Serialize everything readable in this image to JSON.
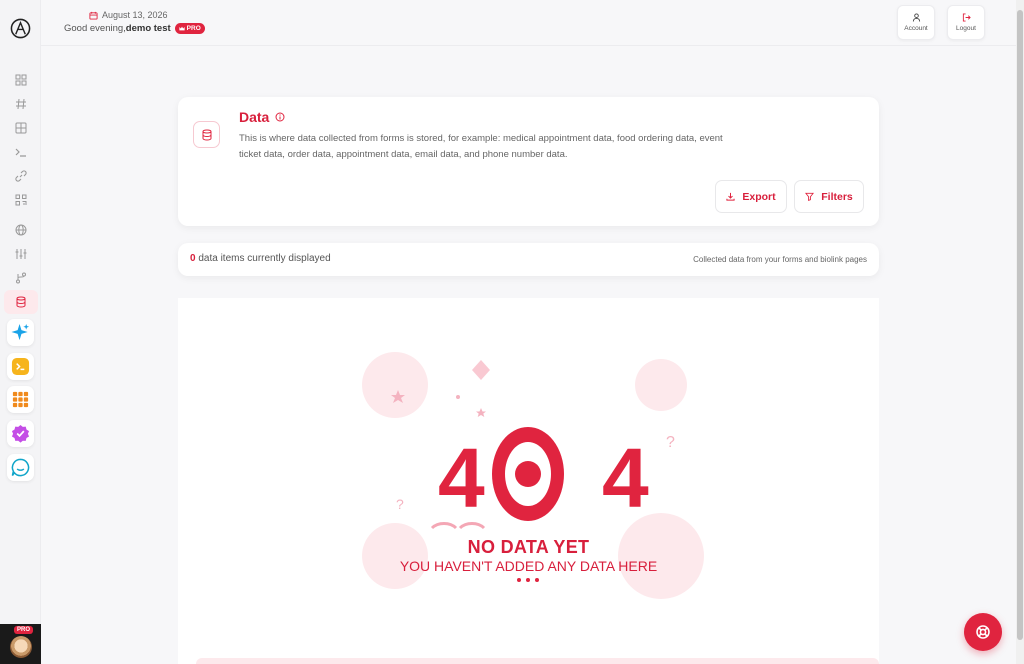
{
  "header": {
    "date": "August 13, 2026",
    "greeting": "Good evening,",
    "user_name": "demo test",
    "plan_badge": "PRO",
    "account_label": "Account",
    "logout_label": "Logout"
  },
  "sidebar": {
    "avatar_badge": "PRO",
    "nav_icons": [
      "grid-icon",
      "hash-icon",
      "table-icon",
      "terminal-icon",
      "link-icon",
      "qr-icon",
      "globe-icon",
      "sliders-icon",
      "branch-icon",
      "database-icon"
    ],
    "active_item": "database-icon",
    "apps": [
      "sparkle-app-icon",
      "terminal-app-icon",
      "grid-app-icon",
      "verified-app-icon",
      "chat-app-icon"
    ]
  },
  "data_section": {
    "title": "Data",
    "description": "This is where data collected from forms is stored, for example: medical appointment data, food ordering data, event ticket data, order data, appointment data, email data, and phone number data.",
    "export_label": "Export",
    "filters_label": "Filters"
  },
  "summary": {
    "count": "0",
    "count_text": "data items currently displayed",
    "subtitle": "Collected data from your forms and biolink pages"
  },
  "empty_state": {
    "code_left": "4",
    "code_right": "4",
    "title": "NO DATA YET",
    "message": "YOU HAVEN'T ADDED ANY DATA HERE"
  },
  "colors": {
    "accent": "#e0243f",
    "accent_text": "#d81f3c",
    "accent_soft": "#fde9ec"
  }
}
